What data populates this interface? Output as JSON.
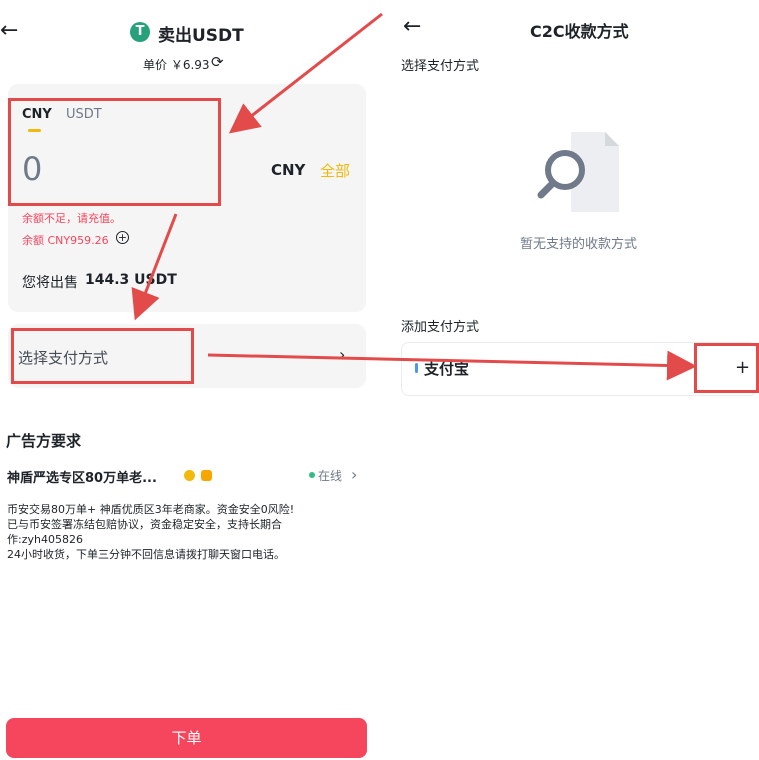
{
  "left": {
    "header": {
      "back_icon": "arrow-left-icon",
      "coin_glyph": "T",
      "title": "卖出USDT",
      "unit_price": "单价 ￥6.93"
    },
    "amount": {
      "tabs": [
        {
          "label": "CNY",
          "active": true
        },
        {
          "label": "USDT",
          "active": false
        }
      ],
      "value": "0",
      "currency": "CNY",
      "all_label": "全部",
      "error": "余额不足，请充值。",
      "balance": "余额 CNY959.26",
      "sell_label": "您将出售",
      "sell_amount": "144.3 USDT"
    },
    "payment": {
      "label": "选择支付方式",
      "chevron": "›"
    },
    "advertiser": {
      "section_title": "广告方要求",
      "name": "神盾严选专区80万单老...",
      "status": "在线",
      "description": "币安交易80万单+  神盾优质区3年老商家。资金安全0风险!\n已与币安签署冻结包赔协议，资金稳定安全，支持长期合作:zyh405826\n24小时收货，下单三分钟不回信息请拨打聊天窗口电话。"
    },
    "order_button": "下单"
  },
  "right": {
    "header": {
      "title": "C2C收款方式"
    },
    "select_title": "选择支付方式",
    "empty_text": "暂无支持的收款方式",
    "add_title": "添加支付方式",
    "method": {
      "name": "支付宝",
      "add": "+"
    }
  },
  "colors": {
    "accent": "#f0b90b",
    "error": "#f6465d",
    "annotation": "#e34b4b",
    "online": "#2ebd85"
  }
}
